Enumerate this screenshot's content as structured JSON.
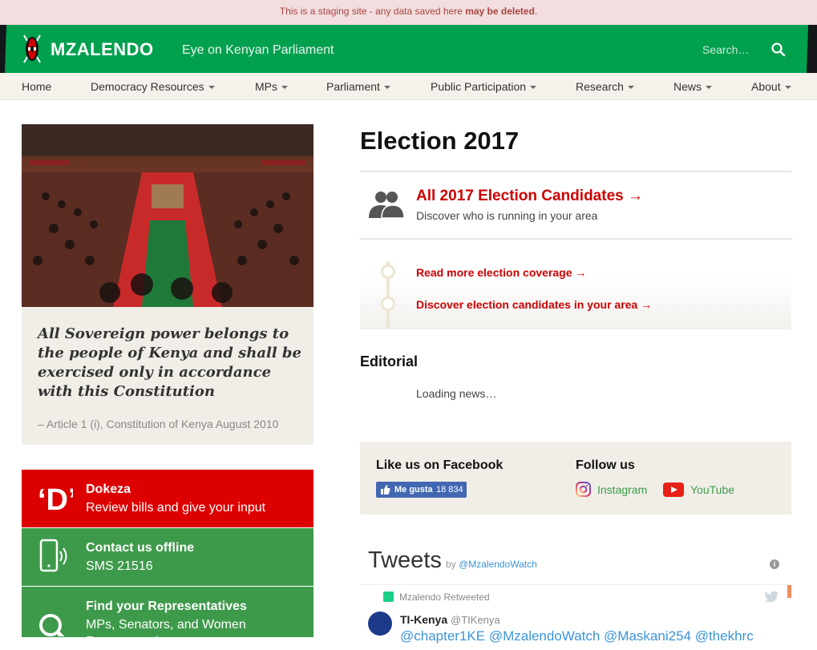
{
  "staging": {
    "text": "This is a staging site - any data saved here ",
    "bold": "may be deleted",
    "end": "."
  },
  "header": {
    "brand": "MZALENDO",
    "tagline": "Eye on Kenyan Parliament",
    "search_placeholder": "Search…",
    "green": "#00a04f",
    "icons": [
      "kenya-shield-icon",
      "search-icon"
    ]
  },
  "nav": {
    "items": [
      {
        "label": "Home",
        "dropdown": false
      },
      {
        "label": "Democracy Resources",
        "dropdown": true
      },
      {
        "label": "MPs",
        "dropdown": true
      },
      {
        "label": "Parliament",
        "dropdown": true
      },
      {
        "label": "Public Participation",
        "dropdown": true
      },
      {
        "label": "Research",
        "dropdown": true
      },
      {
        "label": "News",
        "dropdown": true
      },
      {
        "label": "About",
        "dropdown": true
      }
    ]
  },
  "quote": {
    "text": "All Sovereign power belongs to the people of Kenya and shall be exercised only in accordance with this Constitution",
    "cite": "– Article 1 (i), Constitution of Kenya August 2010"
  },
  "ctas": [
    {
      "title": "Dokeza",
      "sub": "Review bills and give your input",
      "color": "#dc0000"
    },
    {
      "title": "Contact us offline",
      "sub": "SMS 21516",
      "color": "#3e9a4b"
    },
    {
      "title": "Find your Representatives",
      "sub": "MPs, Senators, and Women Representatives",
      "color": "#3e9a4b"
    }
  ],
  "main": {
    "title": "Election 2017",
    "candidates": {
      "title": "All 2017 Election Candidates →",
      "sub": "Discover who is running in your area"
    },
    "links": [
      "Read more election coverage →",
      "Discover election candidates in your area →"
    ],
    "editorial": "Editorial",
    "loading": "Loading news…"
  },
  "social": {
    "facebook_heading": "Like us on Facebook",
    "like_label": "Me gusta",
    "like_count": "18 834",
    "follow_heading": "Follow us",
    "instagram": "Instagram",
    "youtube": "YouTube"
  },
  "tweets": {
    "heading": "Tweets",
    "by": "by ",
    "by_handle": "@MzalendoWatch",
    "retweeted": "Mzalendo Retweeted",
    "name": "TI-Kenya",
    "handle": "@TIKenya",
    "text": "@chapter1KE @MzalendoWatch @Maskani254 @thekhrc"
  }
}
